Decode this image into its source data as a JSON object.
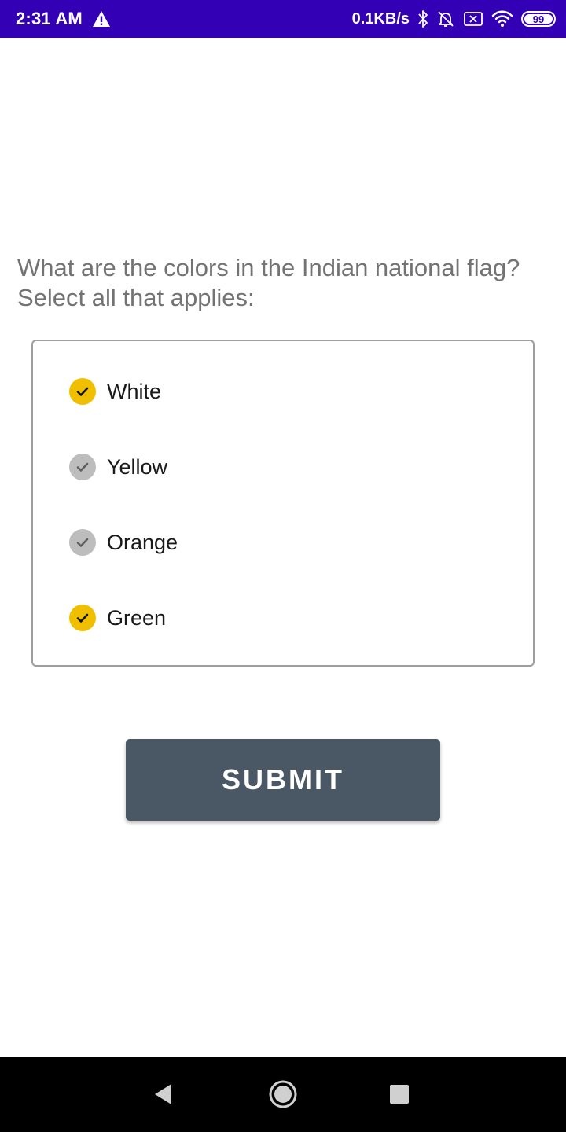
{
  "status_bar": {
    "time": "2:31 AM",
    "net_speed": "0.1KB/s",
    "battery_level": "99",
    "battery_fraction": 0.99,
    "background_color": "#3300b5",
    "icons": [
      "warning-icon",
      "bluetooth-icon",
      "alarm-off-icon",
      "sim-off-icon",
      "wifi-icon",
      "battery-icon"
    ]
  },
  "question": {
    "line1": "What are the colors in the Indian national flag?",
    "line2": "Select all that applies:"
  },
  "options": [
    {
      "label": "White",
      "checked": true
    },
    {
      "label": "Yellow",
      "checked": false
    },
    {
      "label": "Orange",
      "checked": false
    },
    {
      "label": "Green",
      "checked": true
    }
  ],
  "colors": {
    "checked": "#f0c000",
    "unchecked": "#bdbdbd",
    "submit": "#4a5866"
  },
  "submit": {
    "label": "SUBMIT"
  },
  "nav_bar": {
    "icons": [
      "back-icon",
      "home-icon",
      "recents-icon"
    ]
  }
}
